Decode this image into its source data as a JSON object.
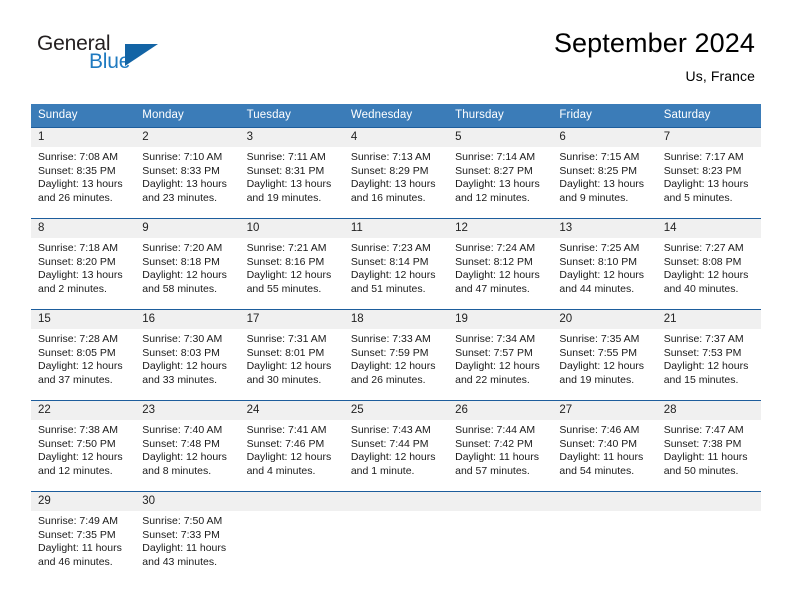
{
  "brand": {
    "name_top": "General",
    "name_bottom": "Blue",
    "logo_icon": "triangle-flag-icon",
    "accent_color": "#1364a5"
  },
  "header": {
    "title": "September 2024",
    "location": "Us, France"
  },
  "theme": {
    "header_blue": "#3b7cb8",
    "row_border_blue": "#1d5d9c",
    "daynum_band": "#f0f0f0"
  },
  "calendar": {
    "weekday_headers": [
      "Sunday",
      "Monday",
      "Tuesday",
      "Wednesday",
      "Thursday",
      "Friday",
      "Saturday"
    ],
    "labels": {
      "sunrise": "Sunrise:",
      "sunset": "Sunset:",
      "daylight": "Daylight:"
    },
    "weeks": [
      [
        {
          "day": "1",
          "sunrise": "Sunrise: 7:08 AM",
          "sunset": "Sunset: 8:35 PM",
          "daylight_1": "Daylight: 13 hours",
          "daylight_2": "and 26 minutes."
        },
        {
          "day": "2",
          "sunrise": "Sunrise: 7:10 AM",
          "sunset": "Sunset: 8:33 PM",
          "daylight_1": "Daylight: 13 hours",
          "daylight_2": "and 23 minutes."
        },
        {
          "day": "3",
          "sunrise": "Sunrise: 7:11 AM",
          "sunset": "Sunset: 8:31 PM",
          "daylight_1": "Daylight: 13 hours",
          "daylight_2": "and 19 minutes."
        },
        {
          "day": "4",
          "sunrise": "Sunrise: 7:13 AM",
          "sunset": "Sunset: 8:29 PM",
          "daylight_1": "Daylight: 13 hours",
          "daylight_2": "and 16 minutes."
        },
        {
          "day": "5",
          "sunrise": "Sunrise: 7:14 AM",
          "sunset": "Sunset: 8:27 PM",
          "daylight_1": "Daylight: 13 hours",
          "daylight_2": "and 12 minutes."
        },
        {
          "day": "6",
          "sunrise": "Sunrise: 7:15 AM",
          "sunset": "Sunset: 8:25 PM",
          "daylight_1": "Daylight: 13 hours",
          "daylight_2": "and 9 minutes."
        },
        {
          "day": "7",
          "sunrise": "Sunrise: 7:17 AM",
          "sunset": "Sunset: 8:23 PM",
          "daylight_1": "Daylight: 13 hours",
          "daylight_2": "and 5 minutes."
        }
      ],
      [
        {
          "day": "8",
          "sunrise": "Sunrise: 7:18 AM",
          "sunset": "Sunset: 8:20 PM",
          "daylight_1": "Daylight: 13 hours",
          "daylight_2": "and 2 minutes."
        },
        {
          "day": "9",
          "sunrise": "Sunrise: 7:20 AM",
          "sunset": "Sunset: 8:18 PM",
          "daylight_1": "Daylight: 12 hours",
          "daylight_2": "and 58 minutes."
        },
        {
          "day": "10",
          "sunrise": "Sunrise: 7:21 AM",
          "sunset": "Sunset: 8:16 PM",
          "daylight_1": "Daylight: 12 hours",
          "daylight_2": "and 55 minutes."
        },
        {
          "day": "11",
          "sunrise": "Sunrise: 7:23 AM",
          "sunset": "Sunset: 8:14 PM",
          "daylight_1": "Daylight: 12 hours",
          "daylight_2": "and 51 minutes."
        },
        {
          "day": "12",
          "sunrise": "Sunrise: 7:24 AM",
          "sunset": "Sunset: 8:12 PM",
          "daylight_1": "Daylight: 12 hours",
          "daylight_2": "and 47 minutes."
        },
        {
          "day": "13",
          "sunrise": "Sunrise: 7:25 AM",
          "sunset": "Sunset: 8:10 PM",
          "daylight_1": "Daylight: 12 hours",
          "daylight_2": "and 44 minutes."
        },
        {
          "day": "14",
          "sunrise": "Sunrise: 7:27 AM",
          "sunset": "Sunset: 8:08 PM",
          "daylight_1": "Daylight: 12 hours",
          "daylight_2": "and 40 minutes."
        }
      ],
      [
        {
          "day": "15",
          "sunrise": "Sunrise: 7:28 AM",
          "sunset": "Sunset: 8:05 PM",
          "daylight_1": "Daylight: 12 hours",
          "daylight_2": "and 37 minutes."
        },
        {
          "day": "16",
          "sunrise": "Sunrise: 7:30 AM",
          "sunset": "Sunset: 8:03 PM",
          "daylight_1": "Daylight: 12 hours",
          "daylight_2": "and 33 minutes."
        },
        {
          "day": "17",
          "sunrise": "Sunrise: 7:31 AM",
          "sunset": "Sunset: 8:01 PM",
          "daylight_1": "Daylight: 12 hours",
          "daylight_2": "and 30 minutes."
        },
        {
          "day": "18",
          "sunrise": "Sunrise: 7:33 AM",
          "sunset": "Sunset: 7:59 PM",
          "daylight_1": "Daylight: 12 hours",
          "daylight_2": "and 26 minutes."
        },
        {
          "day": "19",
          "sunrise": "Sunrise: 7:34 AM",
          "sunset": "Sunset: 7:57 PM",
          "daylight_1": "Daylight: 12 hours",
          "daylight_2": "and 22 minutes."
        },
        {
          "day": "20",
          "sunrise": "Sunrise: 7:35 AM",
          "sunset": "Sunset: 7:55 PM",
          "daylight_1": "Daylight: 12 hours",
          "daylight_2": "and 19 minutes."
        },
        {
          "day": "21",
          "sunrise": "Sunrise: 7:37 AM",
          "sunset": "Sunset: 7:53 PM",
          "daylight_1": "Daylight: 12 hours",
          "daylight_2": "and 15 minutes."
        }
      ],
      [
        {
          "day": "22",
          "sunrise": "Sunrise: 7:38 AM",
          "sunset": "Sunset: 7:50 PM",
          "daylight_1": "Daylight: 12 hours",
          "daylight_2": "and 12 minutes."
        },
        {
          "day": "23",
          "sunrise": "Sunrise: 7:40 AM",
          "sunset": "Sunset: 7:48 PM",
          "daylight_1": "Daylight: 12 hours",
          "daylight_2": "and 8 minutes."
        },
        {
          "day": "24",
          "sunrise": "Sunrise: 7:41 AM",
          "sunset": "Sunset: 7:46 PM",
          "daylight_1": "Daylight: 12 hours",
          "daylight_2": "and 4 minutes."
        },
        {
          "day": "25",
          "sunrise": "Sunrise: 7:43 AM",
          "sunset": "Sunset: 7:44 PM",
          "daylight_1": "Daylight: 12 hours",
          "daylight_2": "and 1 minute."
        },
        {
          "day": "26",
          "sunrise": "Sunrise: 7:44 AM",
          "sunset": "Sunset: 7:42 PM",
          "daylight_1": "Daylight: 11 hours",
          "daylight_2": "and 57 minutes."
        },
        {
          "day": "27",
          "sunrise": "Sunrise: 7:46 AM",
          "sunset": "Sunset: 7:40 PM",
          "daylight_1": "Daylight: 11 hours",
          "daylight_2": "and 54 minutes."
        },
        {
          "day": "28",
          "sunrise": "Sunrise: 7:47 AM",
          "sunset": "Sunset: 7:38 PM",
          "daylight_1": "Daylight: 11 hours",
          "daylight_2": "and 50 minutes."
        }
      ],
      [
        {
          "day": "29",
          "sunrise": "Sunrise: 7:49 AM",
          "sunset": "Sunset: 7:35 PM",
          "daylight_1": "Daylight: 11 hours",
          "daylight_2": "and 46 minutes."
        },
        {
          "day": "30",
          "sunrise": "Sunrise: 7:50 AM",
          "sunset": "Sunset: 7:33 PM",
          "daylight_1": "Daylight: 11 hours",
          "daylight_2": "and 43 minutes."
        },
        {
          "day": "",
          "sunrise": "",
          "sunset": "",
          "daylight_1": "",
          "daylight_2": ""
        },
        {
          "day": "",
          "sunrise": "",
          "sunset": "",
          "daylight_1": "",
          "daylight_2": ""
        },
        {
          "day": "",
          "sunrise": "",
          "sunset": "",
          "daylight_1": "",
          "daylight_2": ""
        },
        {
          "day": "",
          "sunrise": "",
          "sunset": "",
          "daylight_1": "",
          "daylight_2": ""
        },
        {
          "day": "",
          "sunrise": "",
          "sunset": "",
          "daylight_1": "",
          "daylight_2": ""
        }
      ]
    ]
  }
}
